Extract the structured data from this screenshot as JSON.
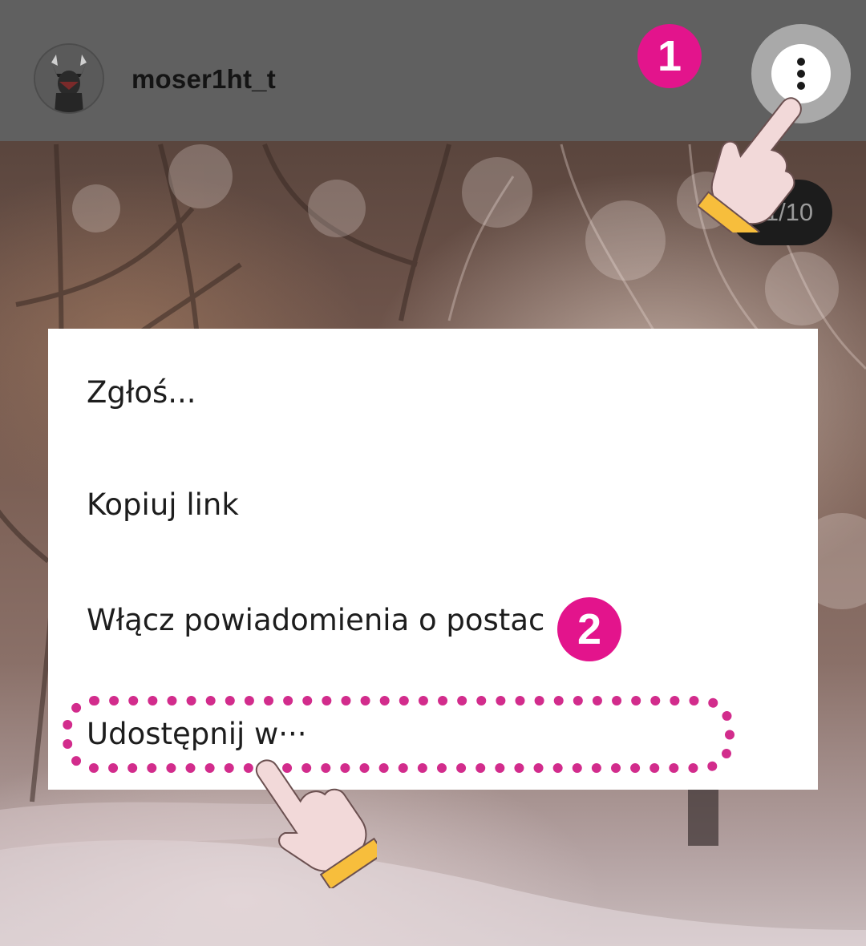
{
  "header": {
    "username": "moser1ht_t"
  },
  "post": {
    "counter": "1/10"
  },
  "menu": {
    "items": [
      {
        "label": "Zgłoś..."
      },
      {
        "label": "Kopiuj link"
      },
      {
        "label": "Włącz powiadomienia o postac"
      },
      {
        "label": "Udostępnij w···"
      }
    ]
  },
  "steps": {
    "step1": "1",
    "step2": "2"
  },
  "colors": {
    "header_bg": "#606060",
    "badge": "#e3148c",
    "highlight": "#d22c8c",
    "hand_skin": "#f2d9d9",
    "hand_cuff": "#f7be3c"
  },
  "icons": {
    "more": "more-vertical-icon",
    "pointer": "pointing-hand-icon"
  }
}
